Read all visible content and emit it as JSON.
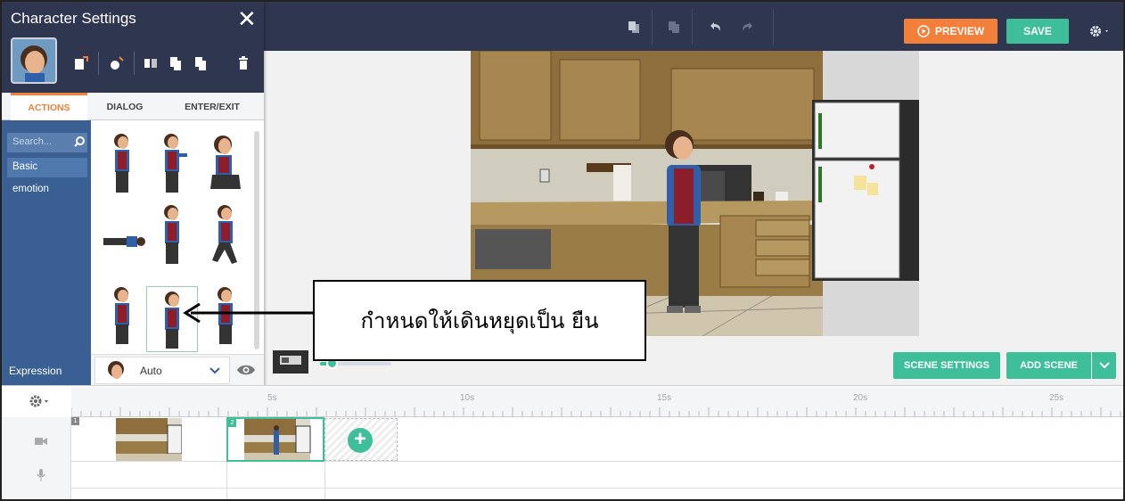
{
  "panel": {
    "title": "Character Settings",
    "close_glyph": "✕",
    "tabs": [
      {
        "label": "ACTIONS",
        "active": true
      },
      {
        "label": "DIALOG",
        "active": false
      },
      {
        "label": "ENTER/EXIT",
        "active": false
      }
    ],
    "search_placeholder": "Search...",
    "categories": [
      {
        "label": "Basic",
        "selected": true
      },
      {
        "label": "emotion",
        "selected": false
      }
    ],
    "expression": {
      "label": "Expression",
      "value": "Auto"
    }
  },
  "toolbar": {
    "preview_label": "PREVIEW",
    "save_label": "SAVE"
  },
  "stage": {
    "scene_settings_label": "SCENE SETTINGS",
    "add_scene_label": "ADD SCENE"
  },
  "timeline": {
    "ruler_labels": [
      "5s",
      "10s",
      "15s",
      "20s",
      "25s"
    ],
    "scenes": [
      {
        "number": "1"
      },
      {
        "number": "2"
      }
    ],
    "new_scene_glyph": "+"
  },
  "annotation": {
    "text": "กำหนดให้เดินหยุดเป็น ยืน"
  },
  "colors": {
    "topbar": "#2f3650",
    "accent_orange": "#f2803b",
    "accent_green": "#3ebf9a",
    "category_blue": "#3a5f92"
  }
}
